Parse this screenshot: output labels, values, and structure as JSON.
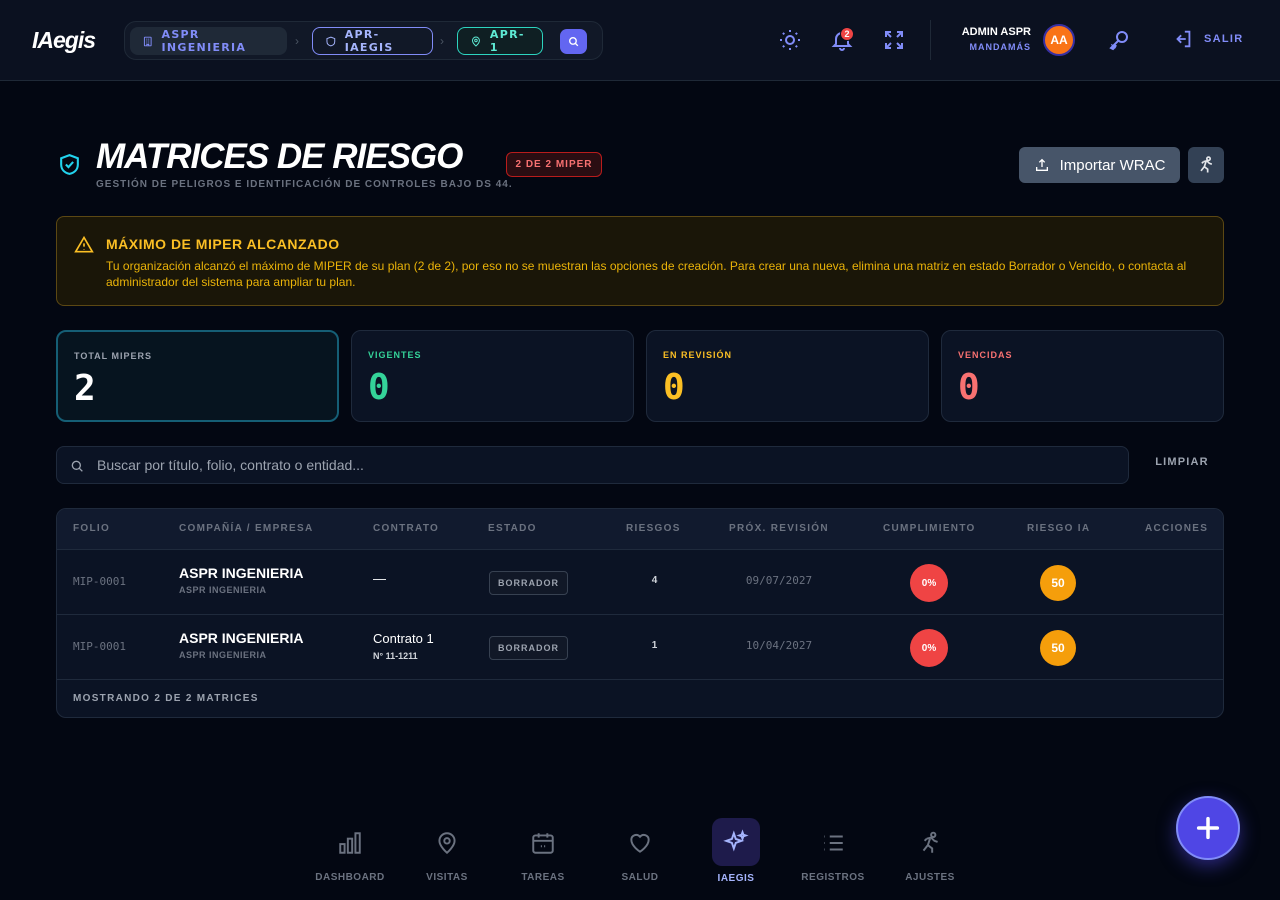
{
  "app": {
    "logo": "IAegis"
  },
  "breadcrumb": {
    "company": "ASPR INGENIERIA",
    "project": "APR-IAEGIS",
    "site": "APR-1"
  },
  "notifications": {
    "count": "2"
  },
  "user": {
    "name": "ADMIN ASPR",
    "role": "MANDAMÁS",
    "initials": "AA"
  },
  "logout_label": "SALIR",
  "header": {
    "title": "MATRICES DE RIESGO",
    "subtitle": "GESTIÓN DE PELIGROS E IDENTIFICACIÓN DE CONTROLES BAJO DS 44.",
    "limit_badge": "2 DE 2 MIPER",
    "import_label": "Importar WRAC"
  },
  "alert": {
    "title": "MÁXIMO DE MIPER ALCANZADO",
    "message": "Tu organización alcanzó el máximo de MIPER de su plan (2 de 2), por eso no se muestran las opciones de creación. Para crear una nueva, elimina una matriz en estado Borrador o Vencido, o contacta al administrador del sistema para ampliar tu plan."
  },
  "stats": [
    {
      "label": "TOTAL MIPERS",
      "value": "2",
      "color": "#ffffff",
      "label_color": "#9ca3af"
    },
    {
      "label": "VIGENTES",
      "value": "0",
      "color": "#34d399",
      "label_color": "#34d399"
    },
    {
      "label": "EN REVISIÓN",
      "value": "0",
      "color": "#fbbf24",
      "label_color": "#fbbf24"
    },
    {
      "label": "VENCIDAS",
      "value": "0",
      "color": "#f87171",
      "label_color": "#f87171"
    }
  ],
  "search": {
    "placeholder": "Buscar por título, folio, contrato o entidad...",
    "value": "",
    "clear_label": "LIMPIAR"
  },
  "table": {
    "columns": [
      "FOLIO",
      "COMPAÑÍA / EMPRESA",
      "CONTRATO",
      "ESTADO",
      "RIESGOS",
      "PRÓX. REVISIÓN",
      "CUMPLIMIENTO",
      "RIESGO IA",
      "ACCIONES"
    ],
    "rows": [
      {
        "folio": "MIP-0001",
        "company": "ASPR INGENIERIA",
        "company_sub": "ASPR INGENIERIA",
        "contract": "—",
        "contract_sub": "",
        "status": "BORRADOR",
        "risks": "4",
        "next_review": "09/07/2027",
        "compliance": "0%",
        "ai_risk": "50"
      },
      {
        "folio": "MIP-0001",
        "company": "ASPR INGENIERIA",
        "company_sub": "ASPR INGENIERIA",
        "contract": "Contrato 1",
        "contract_sub": "N° 11-1211",
        "status": "BORRADOR",
        "risks": "1",
        "next_review": "10/04/2027",
        "compliance": "0%",
        "ai_risk": "50"
      }
    ],
    "footer": "MOSTRANDO 2 DE 2 MATRICES"
  },
  "nav": [
    {
      "label": "DASHBOARD",
      "icon": "bar-chart-icon"
    },
    {
      "label": "VISITAS",
      "icon": "map-pin-icon"
    },
    {
      "label": "TAREAS",
      "icon": "calendar-icon"
    },
    {
      "label": "SALUD",
      "icon": "heart-icon"
    },
    {
      "label": "IAEGIS",
      "icon": "sparkles-icon",
      "active": true
    },
    {
      "label": "REGISTROS",
      "icon": "list-icon"
    },
    {
      "label": "AJUSTES",
      "icon": "runner-icon"
    }
  ],
  "colors": {
    "accent": "#6366f1",
    "danger": "#ef4444",
    "warning": "#f59e0b",
    "success": "#34d399"
  }
}
